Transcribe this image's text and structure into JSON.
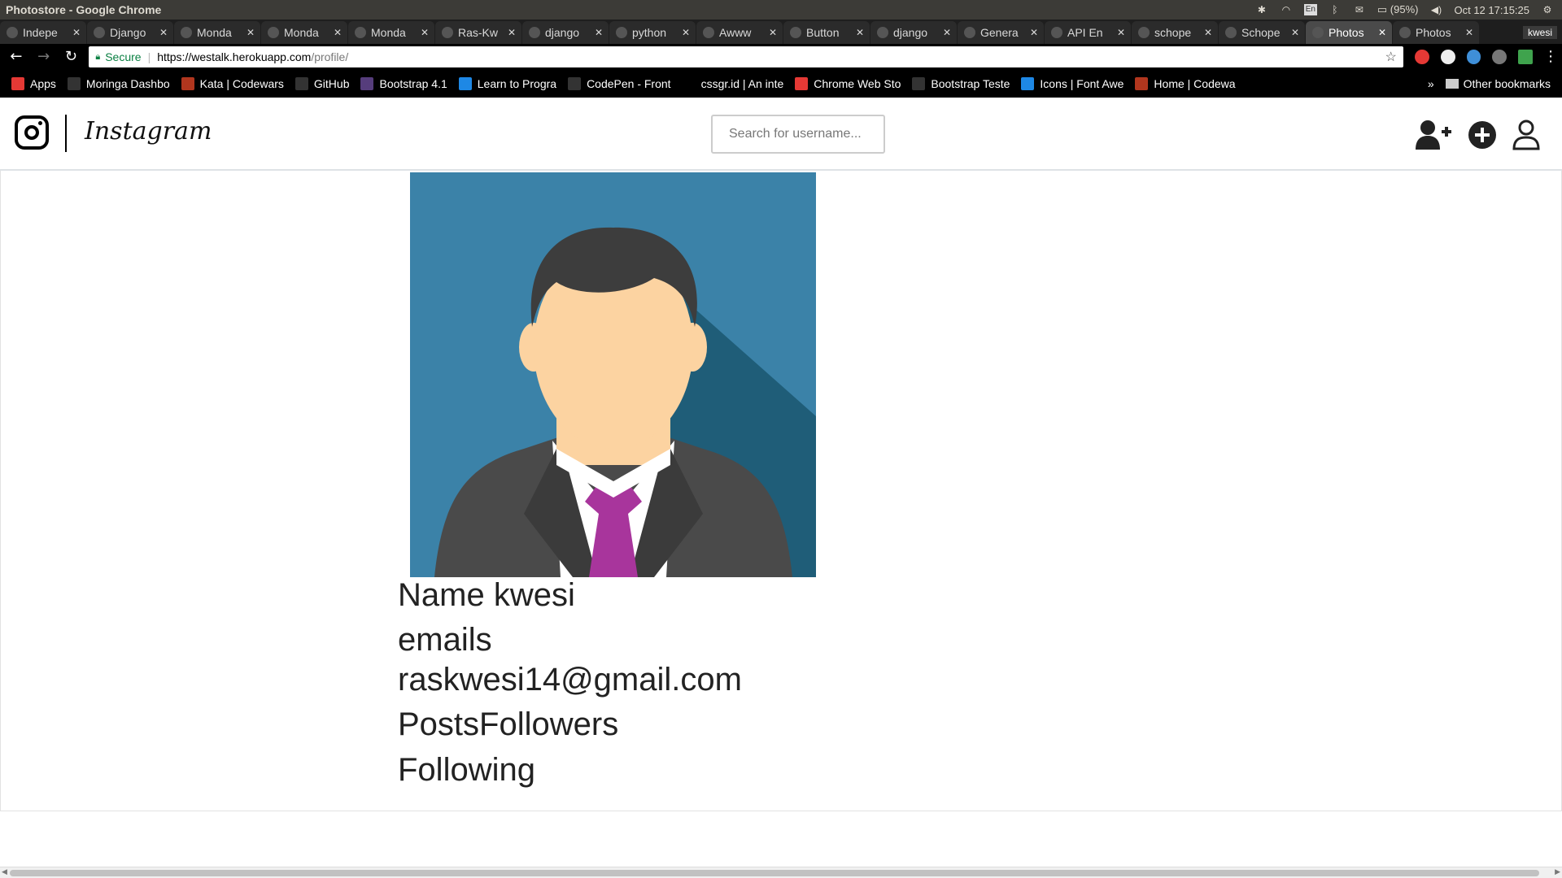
{
  "window": {
    "title": "Photostore - Google Chrome",
    "tray": {
      "keyboard": "En",
      "battery": "(95%)",
      "datetime": "Oct 12 17:15:25"
    }
  },
  "tabs": [
    {
      "label": "Indepe",
      "active": false
    },
    {
      "label": "Django",
      "active": false
    },
    {
      "label": "Monda",
      "active": false
    },
    {
      "label": "Monda",
      "active": false
    },
    {
      "label": "Monda",
      "active": false
    },
    {
      "label": "Ras-Kw",
      "active": false
    },
    {
      "label": "django",
      "active": false
    },
    {
      "label": "python",
      "active": false
    },
    {
      "label": "Awww",
      "active": false
    },
    {
      "label": "Button",
      "active": false
    },
    {
      "label": "django",
      "active": false
    },
    {
      "label": "Genera",
      "active": false
    },
    {
      "label": "API En",
      "active": false
    },
    {
      "label": "schope",
      "active": false
    },
    {
      "label": "Schope",
      "active": false
    },
    {
      "label": "Photos",
      "active": true
    },
    {
      "label": "Photos",
      "active": false
    }
  ],
  "profile_name": "kwesi",
  "tab_close_glyph": "✕",
  "toolbar": {
    "secure_label": "Secure",
    "url_host": "https://westalk.herokuapp.com",
    "url_path": "/profile/"
  },
  "bookmarks": [
    {
      "label": "Apps",
      "icon_color": "#e53935"
    },
    {
      "label": "Moringa Dashbo",
      "icon_color": "#333333"
    },
    {
      "label": "Kata | Codewars",
      "icon_color": "#b1361e"
    },
    {
      "label": "GitHub",
      "icon_color": "#333333"
    },
    {
      "label": "Bootstrap 4.1",
      "icon_color": "#563d7c"
    },
    {
      "label": "Learn to Progra",
      "icon_color": "#1e88e5"
    },
    {
      "label": "CodePen - Front",
      "icon_color": "#333333"
    },
    {
      "label": "cssgr.id | An inte",
      "icon_color": "#000000"
    },
    {
      "label": "Chrome Web Sto",
      "icon_color": "#e53935"
    },
    {
      "label": "Bootstrap Teste",
      "icon_color": "#333333"
    },
    {
      "label": "Icons | Font Awe",
      "icon_color": "#1e88e5"
    },
    {
      "label": "Home | Codewa",
      "icon_color": "#b1361e"
    }
  ],
  "bookmarks_more": "»",
  "other_bookmarks": "Other bookmarks",
  "app": {
    "brand": "Instagram",
    "search_placeholder": "Search for username...",
    "nav_icons": [
      "add-user-icon",
      "plus-circle-icon",
      "user-icon"
    ]
  },
  "profile": {
    "name_line": "Name kwesi",
    "emails_label": "emails",
    "email": "raskwesi14@gmail.com",
    "posts_followers": "PostsFollowers",
    "following": "Following"
  },
  "colors": {
    "avatar_bg": "#3b82a8",
    "avatar_shadow": "#1f5d78",
    "suit": "#4a4a4a",
    "tie": "#a8359c",
    "skin": "#fcd3a1",
    "hair": "#3d3d3d"
  }
}
